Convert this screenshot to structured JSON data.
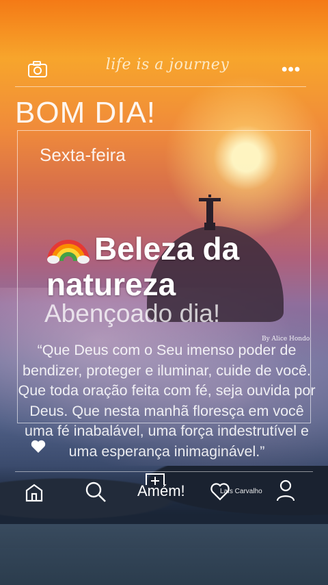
{
  "header": {
    "tagline": "life is a journey",
    "camera_icon": "camera-icon",
    "more_icon": "more-icon",
    "more_glyph": "•••"
  },
  "post": {
    "title": "BOM DIA!",
    "weekday": "Sexta-feira",
    "headline": "Beleza da natureza",
    "headline_emoji": "rainbow-icon",
    "blessing": "Abençoado dia!",
    "credit_top": "By Alice Hondo",
    "quote": "“Que Deus com o Seu imenso poder de bendizer, proteger e iluminar, cuide de você. Que toda oração feita com fé, seja ouvida por Deus. Que nesta manhã floresça em você uma fé inabalável, uma força indestrutível e uma esperança inimaginável.”"
  },
  "nav": {
    "amen_label": "Amém!",
    "credit_bottom": "Laís Carvalho",
    "icons": [
      "home-icon",
      "search-icon",
      "add-icon",
      "heart-icon",
      "user-icon"
    ]
  },
  "colors": {
    "sky_top": "#f47a16",
    "sky_mid": "#b0607a",
    "sky_bottom": "#1a2740",
    "text": "#ffffff"
  }
}
